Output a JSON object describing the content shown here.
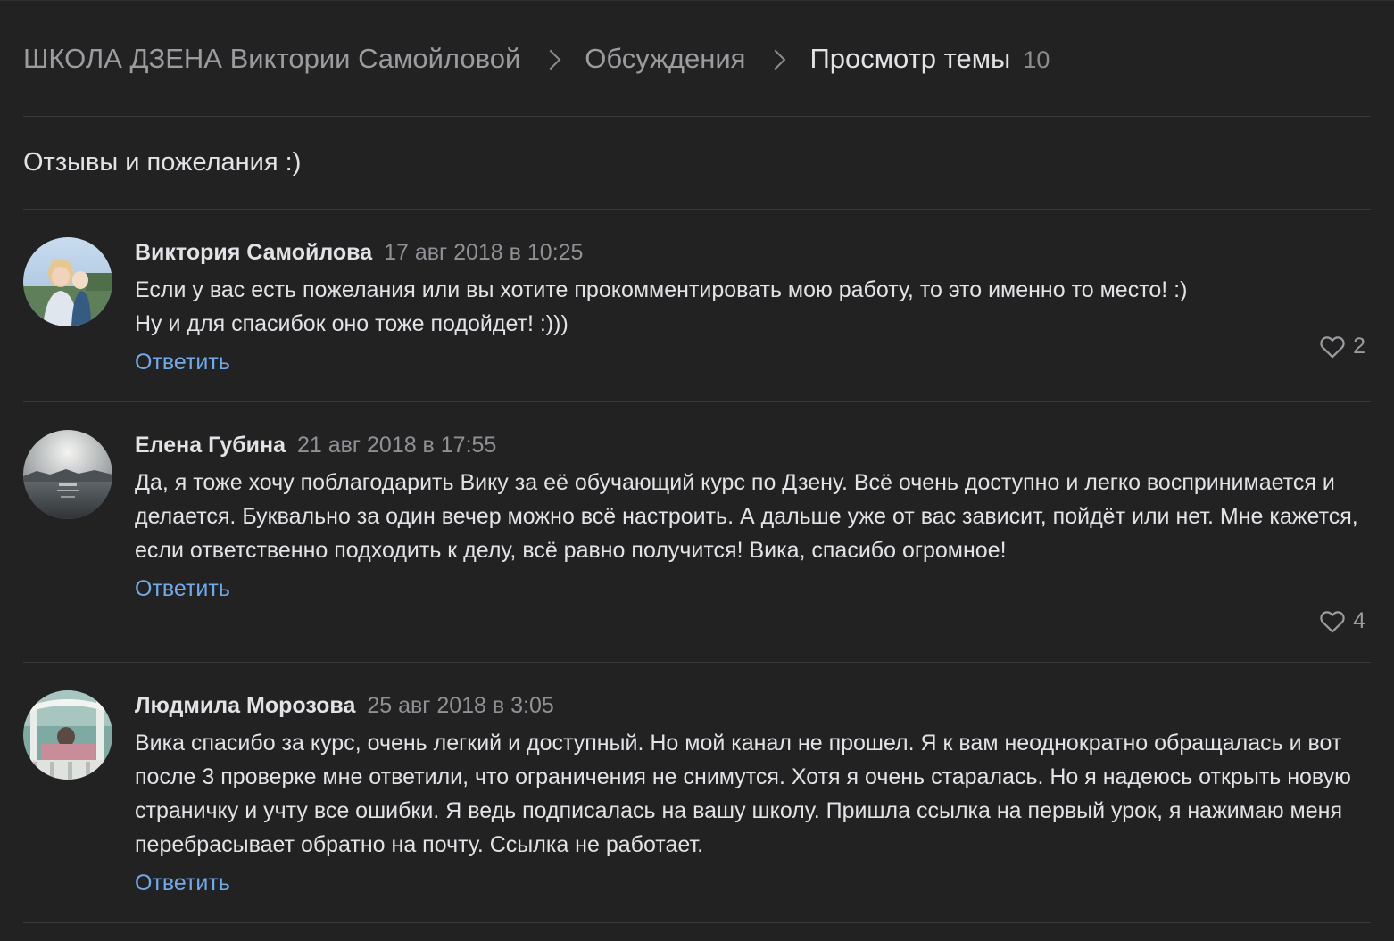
{
  "breadcrumb": {
    "items": [
      "ШКОЛА ДЗЕНА Виктории Самойловой",
      "Обсуждения"
    ],
    "current": "Просмотр темы",
    "count": "10"
  },
  "topic": {
    "title": "Отзывы и пожелания :)"
  },
  "posts": [
    {
      "author": "Виктория Самойлова",
      "date": "17 авг 2018 в 10:25",
      "text": [
        "Если у вас есть пожелания или вы хотите прокомментировать мою работу, то это именно то место! :)",
        "Ну и для спасибок оно тоже подойдет! :)))"
      ],
      "reply_label": "Ответить",
      "likes": "2",
      "avatar_icon": "user-photo-icon"
    },
    {
      "author": "Елена Губина",
      "date": "21 авг 2018 в 17:55",
      "text": [
        "Да, я тоже хочу поблагодарить Вику за её обучающий курс по Дзену. Всё очень доступно и легко воспринимается и делается. Буквально за один вечер можно всё настроить. А дальше уже от вас зависит, пойдёт или нет. Мне кажется, если ответственно подходить к делу, всё равно получится! Вика, спасибо огромное!"
      ],
      "reply_label": "Ответить",
      "likes": "4",
      "avatar_icon": "user-photo-icon"
    },
    {
      "author": "Людмила Морозова",
      "date": "25 авг 2018 в 3:05",
      "text": [
        "Вика спасибо за курс, очень легкий и доступный. Но мой канал не прошел. Я к вам неоднократно обращалась и вот после 3 проверке мне ответили, что ограничения не снимутся. Хотя я очень старалась. Но я надеюсь открыть новую страничку и учту все ошибки. Я ведь подписалась на вашу школу. Пришла ссылка на первый урок, я нажимаю меня перебрасывает обратно на почту. Ссылка не работает."
      ],
      "reply_label": "Ответить",
      "likes": "",
      "avatar_icon": "user-photo-icon"
    }
  ],
  "colors": {
    "background": "#222222",
    "divider": "#3a3a3a",
    "text": "#e1e3e6",
    "muted": "#8f9196",
    "link": "#71aaeb"
  },
  "icons": {
    "separator": "chevron-right-icon",
    "like": "heart-outline-icon"
  }
}
